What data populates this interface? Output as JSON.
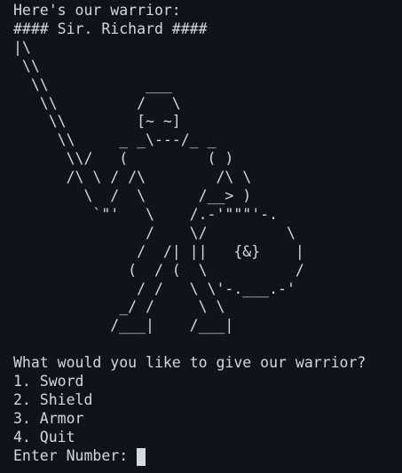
{
  "terminal": {
    "intro": "Here's our warrior:",
    "title": "#### Sir. Richard ####",
    "ascii_art": "|\\\n \\\\\n  \\\\           ___\n   \\\\         /   \\\n    \\\\        [~ ~]\n     \\\\     _ _\\---/_ _\n      \\\\/   (         ( )\n      /\\ \\ / /\\        /\\ \\\n        \\  /  \\      /__> )\n         `\"'   \\    /.-'\"\"\"'-.\n               /    \\/         \\\n              /  /| ||   {&}    |\n             (  / (  \\          /\n              / /   \\ \\'-.___.-'\n            _/ /     \\ \\\n           /___|    /___|",
    "question": "What would you like to give our warrior?",
    "options": [
      "1. Sword",
      "2. Shield",
      "3. Armor",
      "4. Quit"
    ],
    "prompt": "Enter Number: "
  },
  "colors": {
    "background": "#0f131b",
    "text": "#d3d7de",
    "cursor": "#d6d9de"
  }
}
